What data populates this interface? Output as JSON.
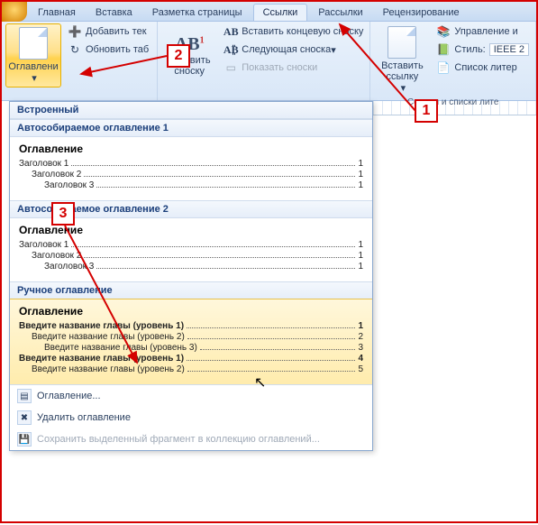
{
  "tabs": {
    "home": "Главная",
    "insert": "Вставка",
    "layout": "Разметка страницы",
    "references": "Ссылки",
    "mail": "Рассылки",
    "review": "Рецензирование"
  },
  "ribbon": {
    "toc": {
      "big": "Оглавлени",
      "addText": "Добавить тек",
      "update": "Обновить таб"
    },
    "footnote": {
      "big": "Вставить\nсноску",
      "ab": "AB",
      "sup": "1",
      "insertEnd": "Вставить концевую сноску",
      "next": "Следующая сноска",
      "show": "Показать сноски"
    },
    "link": {
      "big": "Вставить\nссылку",
      "manage": "Управление и",
      "style": "Стиль:",
      "styleVal": "IEEE 2",
      "bib": "Список литер"
    },
    "caption": {
      "title": "Ссылки и списки лите"
    }
  },
  "gallery": {
    "builtInHdr": "Встроенный",
    "auto1": "Автособираемое оглавление 1",
    "auto2": "Автособираемое оглавление 2",
    "manual": "Ручное оглавление",
    "tocWord": "Оглавление",
    "h1": "Заголовок 1",
    "h2": "Заголовок 2",
    "h3": "Заголовок 3",
    "m1": "Введите название главы (уровень 1)",
    "m2": "Введите название главы (уровень 2)",
    "m3": "Введите название главы (уровень 3)",
    "p1": "1",
    "p2": "2",
    "p3": "3",
    "p4": "4",
    "footer": {
      "custom": "Оглавление...",
      "remove": "Удалить оглавление",
      "save": "Сохранить выделенный фрагмент в коллекцию оглавлений..."
    }
  },
  "anno": {
    "a1": "1",
    "a2": "2",
    "a3": "3"
  }
}
